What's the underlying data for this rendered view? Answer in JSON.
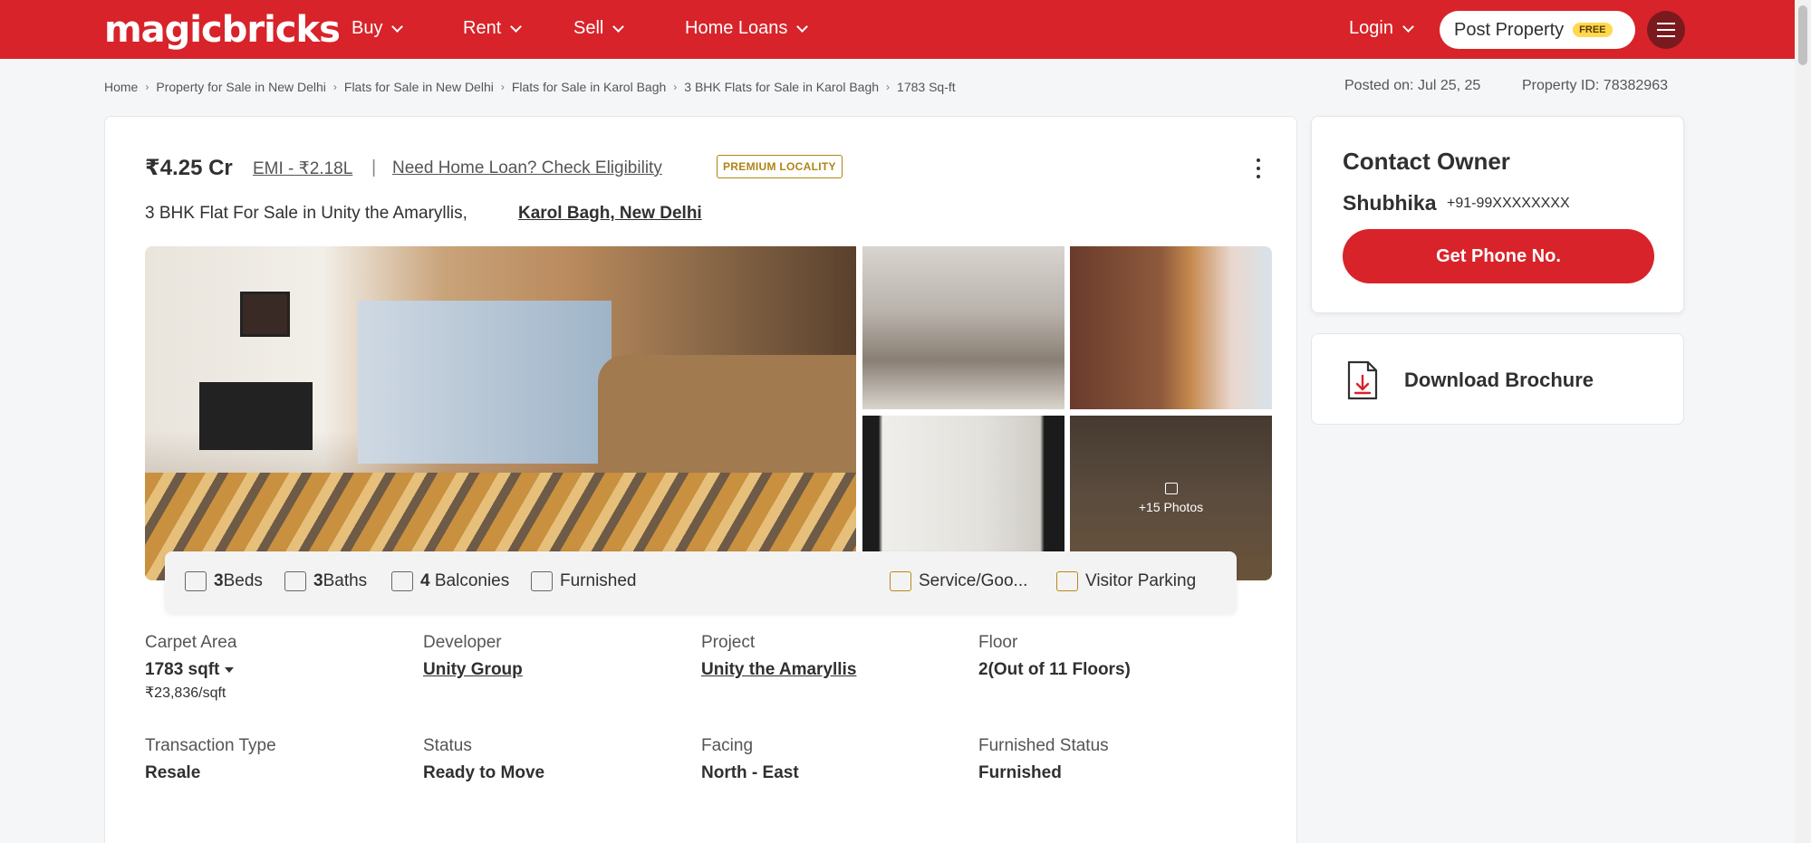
{
  "header": {
    "logo": "magicbricks",
    "nav": [
      {
        "label": "Buy"
      },
      {
        "label": "Rent"
      },
      {
        "label": "Sell"
      },
      {
        "label": "Home Loans"
      }
    ],
    "login_label": "Login",
    "post_property_label": "Post Property",
    "free_badge": "FREE",
    "accent_color": "#d8232a"
  },
  "breadcrumb": [
    "Home",
    "Property for Sale in New Delhi",
    "Flats for Sale in New Delhi",
    "Flats for Sale in Karol Bagh",
    "3 BHK Flats for Sale in Karol Bagh",
    "1783 Sq-ft"
  ],
  "meta": {
    "posted_on": "Posted on: Jul 25, 25",
    "property_id": "Property ID: 78382963"
  },
  "listing": {
    "price": "₹4.25 Cr",
    "emi": "EMI - ₹2.18L",
    "separator": "|",
    "loan_link": "Need Home Loan? Check Eligibility",
    "premium_badge": "PREMIUM LOCALITY",
    "subtitle": "3 BHK Flat For Sale in Unity the Amaryllis,",
    "location_link": "Karol Bagh, New Delhi",
    "more_photos": "+15 Photos"
  },
  "amenities": {
    "beds_count": "3",
    "beds_label": "Beds",
    "baths_count": "3",
    "baths_label": "Baths",
    "balconies_count": "4",
    "balconies_label": "Balconies",
    "furnished": "Furnished",
    "service": "Service/Goo...",
    "parking": "Visitor Parking"
  },
  "details": [
    {
      "label": "Carpet Area",
      "value": "1783 sqft",
      "sub": "₹23,836/sqft"
    },
    {
      "label": "Developer",
      "value": "Unity Group"
    },
    {
      "label": "Project",
      "value": "Unity the Amaryllis"
    },
    {
      "label": "Floor",
      "value": "2(Out of 11 Floors)"
    },
    {
      "label": "Transaction Type",
      "value": "Resale"
    },
    {
      "label": "Status",
      "value": "Ready to Move"
    },
    {
      "label": "Facing",
      "value": "North - East"
    },
    {
      "label": "Furnished Status",
      "value": "Furnished"
    }
  ],
  "contact": {
    "title": "Contact Owner",
    "owner_name": "Shubhika",
    "owner_phone": "+91-99XXXXXXXX",
    "button_label": "Get Phone No."
  },
  "brochure": {
    "label": "Download Brochure"
  }
}
